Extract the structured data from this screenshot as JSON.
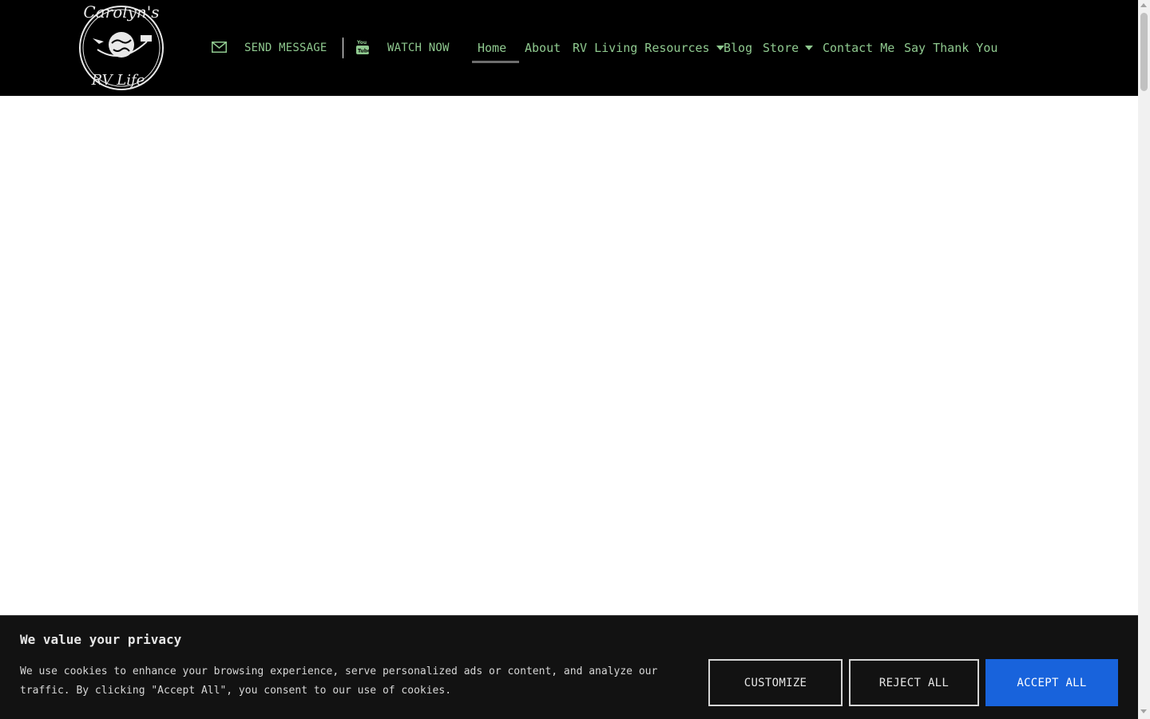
{
  "header": {
    "logo_alt": "Carolyn's RV Life",
    "logo_text_top": "Carolyn's",
    "logo_text_bottom": "RV Life",
    "send_message_label": "SEND MESSAGE",
    "watch_now_label": "WATCH NOW",
    "nav": [
      {
        "label": "Home",
        "active": true,
        "dropdown": false
      },
      {
        "label": "About",
        "active": false,
        "dropdown": false
      },
      {
        "label": "RV Living Resources",
        "active": false,
        "dropdown": true
      },
      {
        "label": "Blog",
        "active": false,
        "dropdown": false
      },
      {
        "label": "Store",
        "active": false,
        "dropdown": true
      },
      {
        "label": "Contact Me",
        "active": false,
        "dropdown": false
      },
      {
        "label": "Say Thank You",
        "active": false,
        "dropdown": false
      }
    ]
  },
  "icons": {
    "mail": "envelope-icon",
    "youtube": "youtube-icon",
    "dropdown": "caret-down-icon"
  },
  "cookie_banner": {
    "title": "We value your privacy",
    "text": "We use cookies to enhance your browsing experience, serve personalized ads or content, and analyze our traffic. By clicking \"Accept All\", you consent to our use of cookies.",
    "customize_label": "CUSTOMIZE",
    "reject_label": "REJECT ALL",
    "accept_label": "ACCEPT ALL"
  },
  "colors": {
    "header_bg": "#000000",
    "nav_text": "#8fc98f",
    "banner_bg": "#121212",
    "accept_bg": "#1863dc"
  }
}
